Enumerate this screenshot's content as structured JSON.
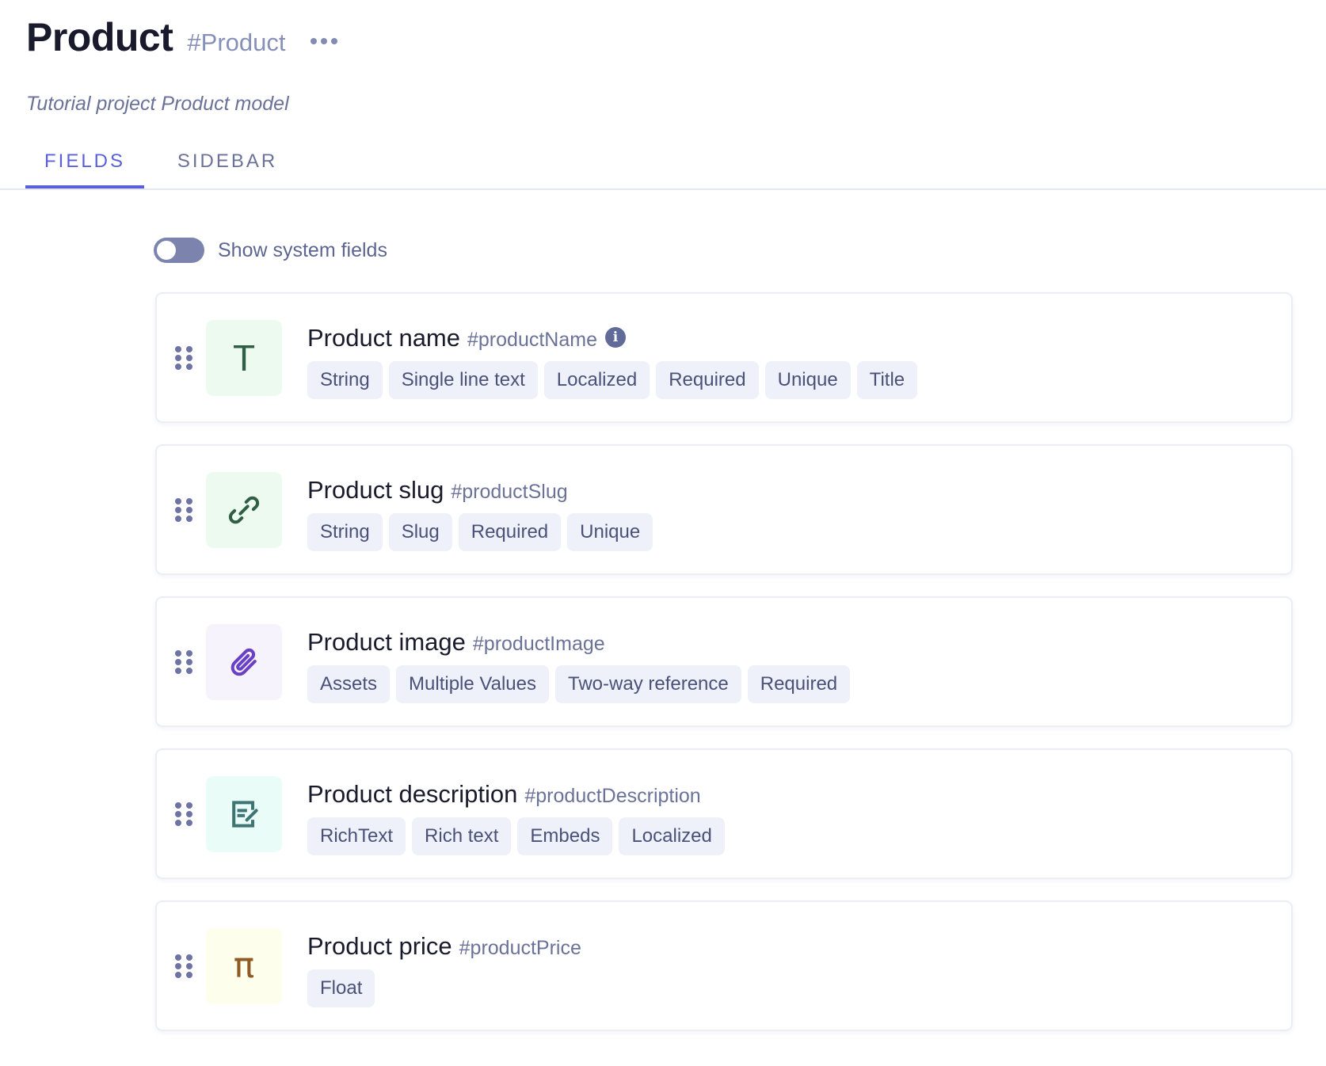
{
  "header": {
    "title": "Product",
    "api_id": "#Product",
    "more_icon": "more-horizontal-icon",
    "description": "Tutorial project Product model"
  },
  "tabs": [
    {
      "label": "FIELDS",
      "active": true
    },
    {
      "label": "SIDEBAR",
      "active": false
    }
  ],
  "system_fields_toggle": {
    "label": "Show system fields",
    "checked": false
  },
  "colors": {
    "accent": "#5a5fdc",
    "tag_bg": "#eef1f9",
    "tag_text": "#4a5178"
  },
  "fields": [
    {
      "name": "Product name",
      "api_id": "#productName",
      "icon": "text-icon",
      "icon_glyph": "T",
      "icon_color": "#2f5e44",
      "icon_bg": "#edfaf0",
      "has_info": true,
      "tags": [
        "String",
        "Single line text",
        "Localized",
        "Required",
        "Unique",
        "Title"
      ]
    },
    {
      "name": "Product slug",
      "api_id": "#productSlug",
      "icon": "link-icon",
      "icon_color": "#2f5e44",
      "icon_bg": "#edfaf0",
      "has_info": false,
      "tags": [
        "String",
        "Slug",
        "Required",
        "Unique"
      ]
    },
    {
      "name": "Product image",
      "api_id": "#productImage",
      "icon": "paperclip-icon",
      "icon_color": "#6a40c4",
      "icon_bg": "#f6f3fd",
      "has_info": false,
      "tags": [
        "Assets",
        "Multiple Values",
        "Two-way reference",
        "Required"
      ]
    },
    {
      "name": "Product description",
      "api_id": "#productDescription",
      "icon": "rich-text-edit-icon",
      "icon_color": "#3e7474",
      "icon_bg": "#eafcf8",
      "has_info": false,
      "tags": [
        "RichText",
        "Rich text",
        "Embeds",
        "Localized"
      ]
    },
    {
      "name": "Product price",
      "api_id": "#productPrice",
      "icon": "pi-icon",
      "icon_glyph": "π",
      "icon_color": "#8f5a24",
      "icon_bg": "#fefeec",
      "has_info": false,
      "tags": [
        "Float"
      ]
    }
  ]
}
